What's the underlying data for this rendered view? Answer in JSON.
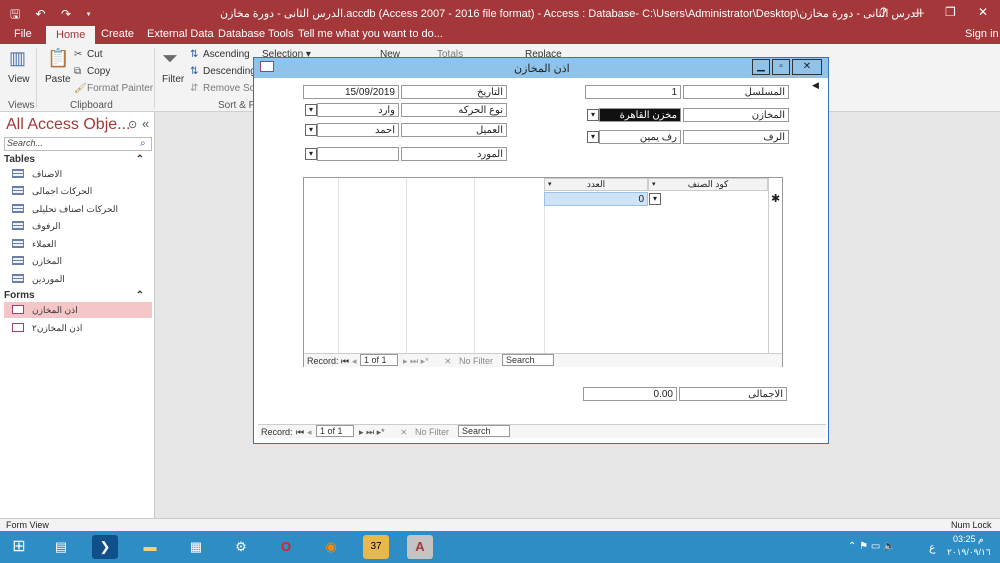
{
  "titlebar": {
    "title": "الدرس الثانى - دورة مخازن.accdb (Access 2007 - 2016 file format) - Access : Database- C:\\Users\\Administrator\\Desktop\\الدرس الثانى - دورة مخازن",
    "help": "?",
    "min": "—",
    "restore": "❐",
    "close": "✕",
    "qat": "🖫 ↶ ↷ ▾"
  },
  "tabs": {
    "file": "File",
    "home": "Home",
    "create": "Create",
    "external": "External Data",
    "dbtools": "Database Tools",
    "tell": "Tell me what you want to do...",
    "signin": "Sign in"
  },
  "ribbon": {
    "view": "View",
    "paste": "Paste",
    "cut": "Cut",
    "copy": "Copy",
    "format_painter": "Format Painter",
    "filter": "Filter",
    "ascending": "Ascending",
    "descending": "Descending",
    "remove_sort": "Remove Sort",
    "selection": "Selection ▾",
    "new": "New",
    "totals": "Totals",
    "replace": "Replace",
    "grp_views": "Views",
    "grp_clipboard": "Clipboard",
    "grp_sort": "Sort & Fi"
  },
  "nav": {
    "title": "All Access Obje...",
    "search_placeholder": "Search...",
    "tables_header": "Tables",
    "forms_header": "Forms",
    "tables": [
      "الاصناف",
      "الحركات اجمالى",
      "الحركات اصناف تحليلى",
      "الرفوف",
      "العملاء",
      "المخازن",
      "الموردين"
    ],
    "forms": [
      "اذن المخازن",
      "اذن المخازن٢"
    ]
  },
  "form": {
    "title": "اذن المخازن",
    "serial_label": "المسلسل",
    "serial_value": "1",
    "store_label": "المخازن",
    "store_value": "مخزن القاهرة",
    "shelf_label": "الرف",
    "shelf_value": "رف يمين",
    "date_label": "التاريخ",
    "date_value": "15/09/2019",
    "movetype_label": "نوع الحركه",
    "movetype_value": "وارد",
    "customer_label": "العميل",
    "customer_value": "احمد",
    "supplier_label": "المورد",
    "supplier_value": "",
    "col_code": "كود الصنف",
    "col_qty": "العدد",
    "qty_value": "0",
    "total_label": "الاجمالى",
    "total_value": "0.00",
    "sub_record_label": "Record:",
    "sub_record_pos": "1 of 1",
    "sub_nofilter": "No Filter",
    "sub_search": "Search",
    "record_label": "Record:",
    "record_pos": "1 of 1",
    "nofilter": "No Filter",
    "search": "Search"
  },
  "status": {
    "left": "Form View",
    "right": "Num Lock"
  },
  "clock": {
    "time": "03:25 م",
    "date": "٢٠١٩/٠٩/١٦",
    "lang": "ع"
  }
}
